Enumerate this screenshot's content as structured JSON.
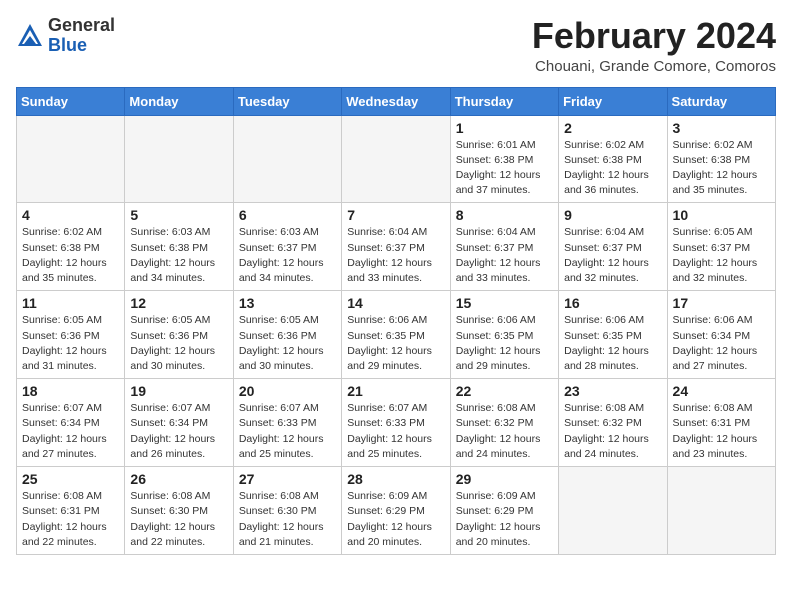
{
  "header": {
    "logo_line1": "General",
    "logo_line2": "Blue",
    "month_year": "February 2024",
    "location": "Chouani, Grande Comore, Comoros"
  },
  "days_of_week": [
    "Sunday",
    "Monday",
    "Tuesday",
    "Wednesday",
    "Thursday",
    "Friday",
    "Saturday"
  ],
  "weeks": [
    [
      {
        "day": "",
        "info": ""
      },
      {
        "day": "",
        "info": ""
      },
      {
        "day": "",
        "info": ""
      },
      {
        "day": "",
        "info": ""
      },
      {
        "day": "1",
        "info": "Sunrise: 6:01 AM\nSunset: 6:38 PM\nDaylight: 12 hours and 37 minutes."
      },
      {
        "day": "2",
        "info": "Sunrise: 6:02 AM\nSunset: 6:38 PM\nDaylight: 12 hours and 36 minutes."
      },
      {
        "day": "3",
        "info": "Sunrise: 6:02 AM\nSunset: 6:38 PM\nDaylight: 12 hours and 35 minutes."
      }
    ],
    [
      {
        "day": "4",
        "info": "Sunrise: 6:02 AM\nSunset: 6:38 PM\nDaylight: 12 hours and 35 minutes."
      },
      {
        "day": "5",
        "info": "Sunrise: 6:03 AM\nSunset: 6:38 PM\nDaylight: 12 hours and 34 minutes."
      },
      {
        "day": "6",
        "info": "Sunrise: 6:03 AM\nSunset: 6:37 PM\nDaylight: 12 hours and 34 minutes."
      },
      {
        "day": "7",
        "info": "Sunrise: 6:04 AM\nSunset: 6:37 PM\nDaylight: 12 hours and 33 minutes."
      },
      {
        "day": "8",
        "info": "Sunrise: 6:04 AM\nSunset: 6:37 PM\nDaylight: 12 hours and 33 minutes."
      },
      {
        "day": "9",
        "info": "Sunrise: 6:04 AM\nSunset: 6:37 PM\nDaylight: 12 hours and 32 minutes."
      },
      {
        "day": "10",
        "info": "Sunrise: 6:05 AM\nSunset: 6:37 PM\nDaylight: 12 hours and 32 minutes."
      }
    ],
    [
      {
        "day": "11",
        "info": "Sunrise: 6:05 AM\nSunset: 6:36 PM\nDaylight: 12 hours and 31 minutes."
      },
      {
        "day": "12",
        "info": "Sunrise: 6:05 AM\nSunset: 6:36 PM\nDaylight: 12 hours and 30 minutes."
      },
      {
        "day": "13",
        "info": "Sunrise: 6:05 AM\nSunset: 6:36 PM\nDaylight: 12 hours and 30 minutes."
      },
      {
        "day": "14",
        "info": "Sunrise: 6:06 AM\nSunset: 6:35 PM\nDaylight: 12 hours and 29 minutes."
      },
      {
        "day": "15",
        "info": "Sunrise: 6:06 AM\nSunset: 6:35 PM\nDaylight: 12 hours and 29 minutes."
      },
      {
        "day": "16",
        "info": "Sunrise: 6:06 AM\nSunset: 6:35 PM\nDaylight: 12 hours and 28 minutes."
      },
      {
        "day": "17",
        "info": "Sunrise: 6:06 AM\nSunset: 6:34 PM\nDaylight: 12 hours and 27 minutes."
      }
    ],
    [
      {
        "day": "18",
        "info": "Sunrise: 6:07 AM\nSunset: 6:34 PM\nDaylight: 12 hours and 27 minutes."
      },
      {
        "day": "19",
        "info": "Sunrise: 6:07 AM\nSunset: 6:34 PM\nDaylight: 12 hours and 26 minutes."
      },
      {
        "day": "20",
        "info": "Sunrise: 6:07 AM\nSunset: 6:33 PM\nDaylight: 12 hours and 25 minutes."
      },
      {
        "day": "21",
        "info": "Sunrise: 6:07 AM\nSunset: 6:33 PM\nDaylight: 12 hours and 25 minutes."
      },
      {
        "day": "22",
        "info": "Sunrise: 6:08 AM\nSunset: 6:32 PM\nDaylight: 12 hours and 24 minutes."
      },
      {
        "day": "23",
        "info": "Sunrise: 6:08 AM\nSunset: 6:32 PM\nDaylight: 12 hours and 24 minutes."
      },
      {
        "day": "24",
        "info": "Sunrise: 6:08 AM\nSunset: 6:31 PM\nDaylight: 12 hours and 23 minutes."
      }
    ],
    [
      {
        "day": "25",
        "info": "Sunrise: 6:08 AM\nSunset: 6:31 PM\nDaylight: 12 hours and 22 minutes."
      },
      {
        "day": "26",
        "info": "Sunrise: 6:08 AM\nSunset: 6:30 PM\nDaylight: 12 hours and 22 minutes."
      },
      {
        "day": "27",
        "info": "Sunrise: 6:08 AM\nSunset: 6:30 PM\nDaylight: 12 hours and 21 minutes."
      },
      {
        "day": "28",
        "info": "Sunrise: 6:09 AM\nSunset: 6:29 PM\nDaylight: 12 hours and 20 minutes."
      },
      {
        "day": "29",
        "info": "Sunrise: 6:09 AM\nSunset: 6:29 PM\nDaylight: 12 hours and 20 minutes."
      },
      {
        "day": "",
        "info": ""
      },
      {
        "day": "",
        "info": ""
      }
    ]
  ]
}
